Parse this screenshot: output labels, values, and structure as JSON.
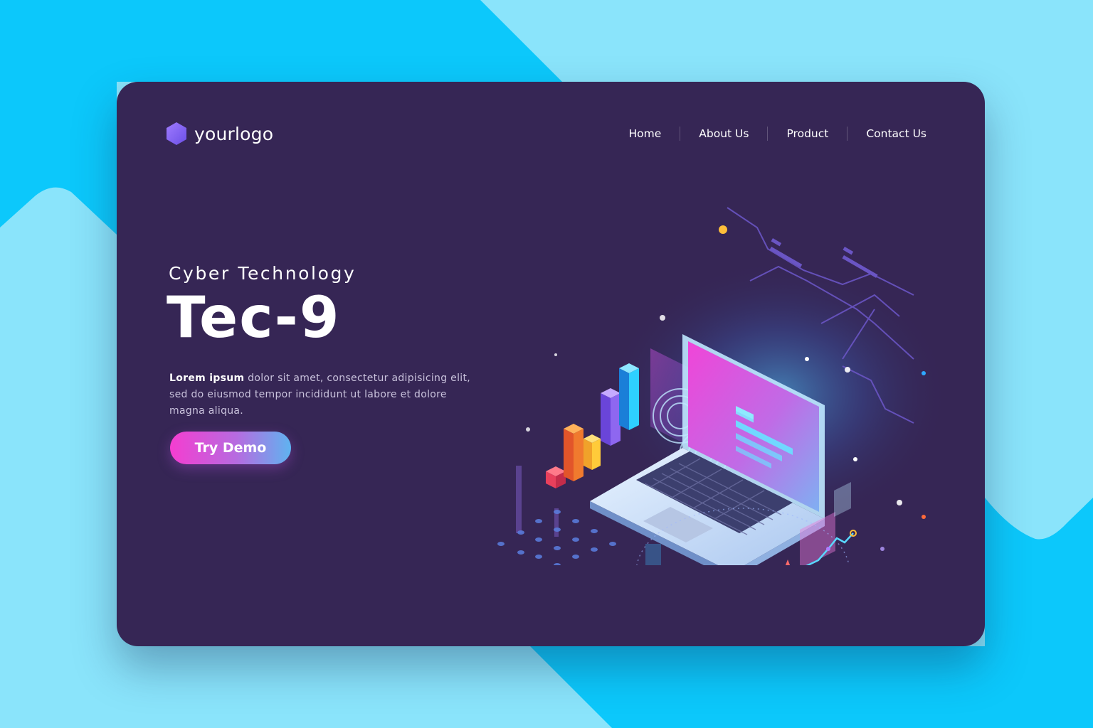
{
  "brand": {
    "logo_text": "yourlogo",
    "logo_icon": "hexagon-icon",
    "logo_color": "#8b6cf6"
  },
  "nav": {
    "items": [
      {
        "label": "Home"
      },
      {
        "label": "About Us"
      },
      {
        "label": "Product"
      },
      {
        "label": "Contact Us"
      }
    ]
  },
  "hero": {
    "subtitle": "Cyber Technology",
    "title": "Tec-9",
    "description_strong": "Lorem ipsum",
    "description_rest": " dolor sit amet, consectetur adipisicing elit, sed do eiusmod tempor incididunt ut labore et dolore magna aliqua.",
    "cta_label": "Try Demo"
  },
  "colors": {
    "page_bg": "#8ae4fb",
    "accent_cyan": "#0cc8fb",
    "card_bg": "#362655",
    "cta_start": "#f53dd0",
    "cta_end": "#5fb3f0"
  },
  "illustration": {
    "icon": "isometric-laptop-illustration"
  }
}
